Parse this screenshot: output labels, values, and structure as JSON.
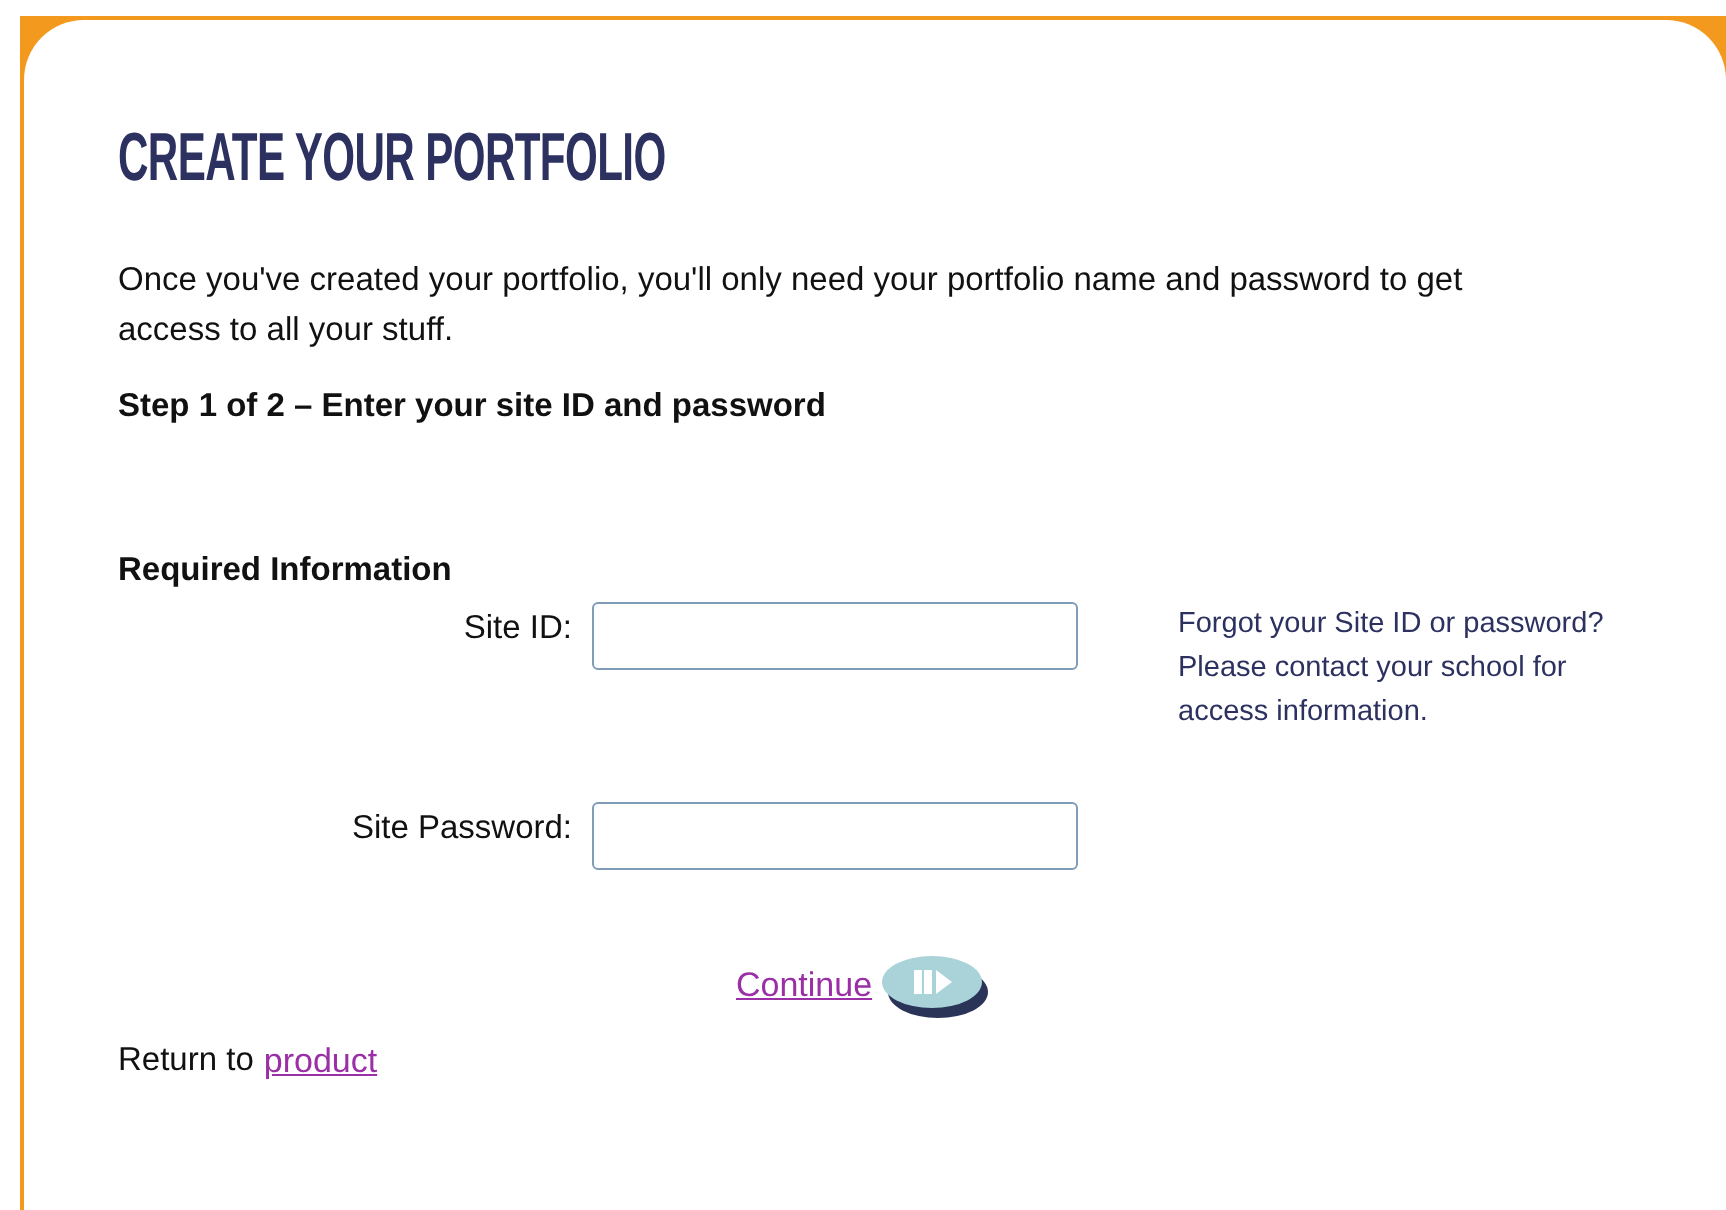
{
  "title": "CREATE YOUR PORTFOLIO",
  "intro": "Once you've created your portfolio, you'll only need your portfolio name and password to get access to all your stuff.",
  "step": "Step 1 of 2 – Enter your site ID and password",
  "section": "Required Information",
  "fields": [
    {
      "label": "Site ID:"
    },
    {
      "label": "Site Password:"
    }
  ],
  "help": "Forgot your Site ID or password? Please contact your school for access information.",
  "continue": "Continue",
  "return_text": "Return to",
  "return_link": "product"
}
